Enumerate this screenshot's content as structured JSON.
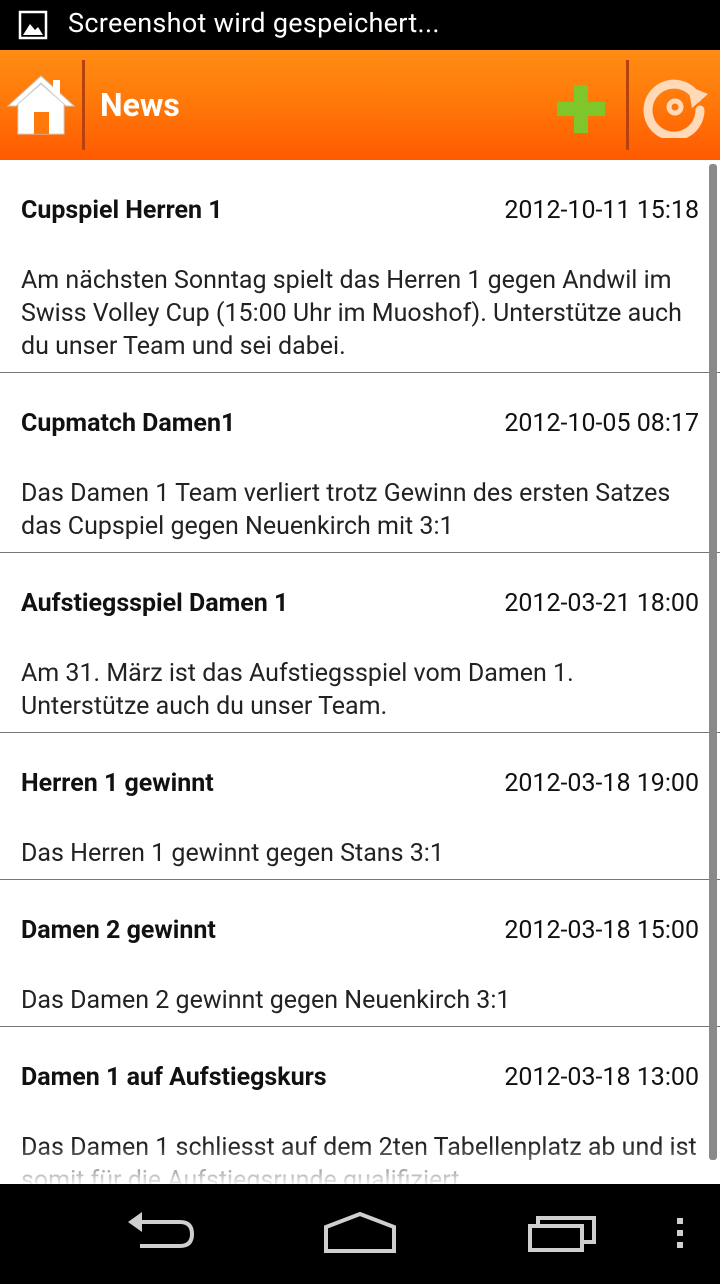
{
  "status_bar": {
    "notification_text": "Screenshot wird gespeichert...",
    "icon": "image-icon"
  },
  "action_bar": {
    "title": "News",
    "home_icon": "home-icon",
    "add_icon": "plus-icon",
    "refresh_icon": "refresh-icon",
    "accent": "#ff7a0a",
    "add_color": "#7ec62a"
  },
  "news": {
    "items": [
      {
        "title": "Cupspiel Herren 1",
        "date": "2012-10-11 15:18",
        "body": "Am nächsten Sonntag spielt das Herren 1 gegen Andwil im Swiss Volley Cup (15:00 Uhr im Muoshof). Unterstütze auch du unser Team und sei dabei."
      },
      {
        "title": "Cupmatch Damen1",
        "date": "2012-10-05 08:17",
        "body": "Das Damen 1 Team verliert trotz Gewinn des ersten Satzes das Cupspiel gegen Neuenkirch mit 3:1"
      },
      {
        "title": "Aufstiegsspiel Damen 1",
        "date": "2012-03-21 18:00",
        "body": "Am 31. März ist das Aufstiegsspiel vom Damen 1. Unterstütze auch du unser Team."
      },
      {
        "title": "Herren 1 gewinnt",
        "date": "2012-03-18 19:00",
        "body": "Das Herren 1 gewinnt gegen Stans 3:1"
      },
      {
        "title": "Damen 2 gewinnt",
        "date": "2012-03-18 15:00",
        "body": "Das Damen 2 gewinnt gegen Neuenkirch 3:1"
      },
      {
        "title": "Damen 1 auf Aufstiegskurs",
        "date": "2012-03-18 13:00",
        "body": "Das Damen 1 schliesst auf dem 2ten Tabellenplatz ab und ist somit für die Aufstiegsrunde qualifiziert."
      }
    ]
  },
  "nav_bar": {
    "back_icon": "back-icon",
    "home_icon": "nav-home-icon",
    "recents_icon": "recent-apps-icon",
    "menu_icon": "overflow-menu-icon"
  }
}
